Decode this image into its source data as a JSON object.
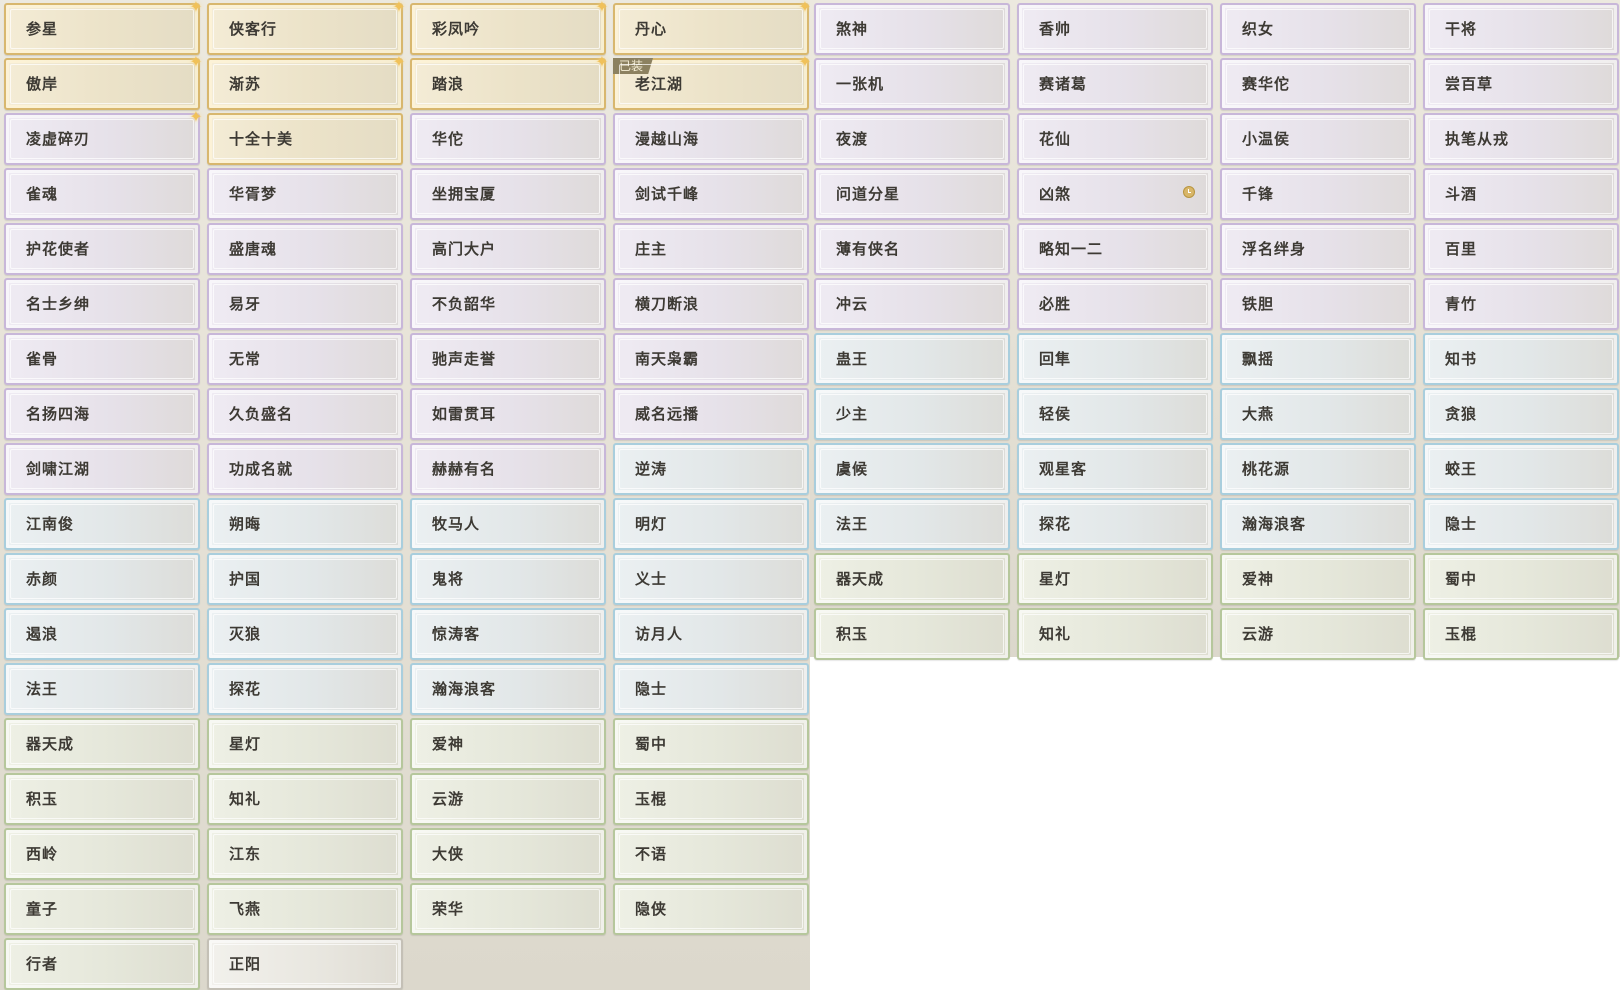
{
  "left_panel": {
    "tiles": [
      {
        "label": "参星",
        "style": "gold",
        "sparkle": true
      },
      {
        "label": "侠客行",
        "style": "gold",
        "sparkle": true
      },
      {
        "label": "彩凤吟",
        "style": "gold",
        "sparkle": true
      },
      {
        "label": "丹心",
        "style": "gold",
        "sparkle": true
      },
      {
        "label": "傲岸",
        "style": "gold",
        "sparkle": true
      },
      {
        "label": "渐苏",
        "style": "gold",
        "sparkle": true
      },
      {
        "label": "踏浪",
        "style": "gold",
        "sparkle": true
      },
      {
        "label": "老江湖",
        "style": "gold",
        "sparkle": true,
        "badge": "已装"
      },
      {
        "label": "凌虚碎刃",
        "style": "purple",
        "sparkle": true
      },
      {
        "label": "十全十美",
        "style": "gold"
      },
      {
        "label": "华佗",
        "style": "purple"
      },
      {
        "label": "漫越山海",
        "style": "purple"
      },
      {
        "label": "雀魂",
        "style": "purple"
      },
      {
        "label": "华胥梦",
        "style": "purple"
      },
      {
        "label": "坐拥宝厦",
        "style": "purple"
      },
      {
        "label": "剑试千峰",
        "style": "purple"
      },
      {
        "label": "护花使者",
        "style": "purple"
      },
      {
        "label": "盛唐魂",
        "style": "purple"
      },
      {
        "label": "高门大户",
        "style": "purple"
      },
      {
        "label": "庄主",
        "style": "purple"
      },
      {
        "label": "名士乡绅",
        "style": "purple"
      },
      {
        "label": "易牙",
        "style": "purple"
      },
      {
        "label": "不负韶华",
        "style": "purple"
      },
      {
        "label": "横刀断浪",
        "style": "purple"
      },
      {
        "label": "雀骨",
        "style": "purple"
      },
      {
        "label": "无常",
        "style": "purple"
      },
      {
        "label": "驰声走誉",
        "style": "purple"
      },
      {
        "label": "南天枭霸",
        "style": "purple"
      },
      {
        "label": "名扬四海",
        "style": "purple"
      },
      {
        "label": "久负盛名",
        "style": "purple"
      },
      {
        "label": "如雷贯耳",
        "style": "purple"
      },
      {
        "label": "威名远播",
        "style": "purple"
      },
      {
        "label": "剑啸江湖",
        "style": "purple"
      },
      {
        "label": "功成名就",
        "style": "purple"
      },
      {
        "label": "赫赫有名",
        "style": "purple"
      },
      {
        "label": "逆涛",
        "style": "blue"
      },
      {
        "label": "江南俊",
        "style": "blue"
      },
      {
        "label": "朔晦",
        "style": "blue"
      },
      {
        "label": "牧马人",
        "style": "blue"
      },
      {
        "label": "明灯",
        "style": "blue"
      },
      {
        "label": "赤颜",
        "style": "blue"
      },
      {
        "label": "护国",
        "style": "blue"
      },
      {
        "label": "鬼将",
        "style": "blue"
      },
      {
        "label": "义士",
        "style": "blue"
      },
      {
        "label": "遏浪",
        "style": "blue"
      },
      {
        "label": "灭狼",
        "style": "blue"
      },
      {
        "label": "惊涛客",
        "style": "blue"
      },
      {
        "label": "访月人",
        "style": "blue"
      },
      {
        "label": "法王",
        "style": "blue"
      },
      {
        "label": "探花",
        "style": "blue"
      },
      {
        "label": "瀚海浪客",
        "style": "blue"
      },
      {
        "label": "隐士",
        "style": "blue"
      },
      {
        "label": "器天成",
        "style": "green"
      },
      {
        "label": "星灯",
        "style": "green"
      },
      {
        "label": "爱神",
        "style": "green"
      },
      {
        "label": "蜀中",
        "style": "green"
      },
      {
        "label": "积玉",
        "style": "green"
      },
      {
        "label": "知礼",
        "style": "green"
      },
      {
        "label": "云游",
        "style": "green"
      },
      {
        "label": "玉棍",
        "style": "green"
      },
      {
        "label": "西岭",
        "style": "green"
      },
      {
        "label": "江东",
        "style": "green"
      },
      {
        "label": "大侠",
        "style": "green"
      },
      {
        "label": "不语",
        "style": "green"
      },
      {
        "label": "童子",
        "style": "green"
      },
      {
        "label": "飞燕",
        "style": "green"
      },
      {
        "label": "荣华",
        "style": "green"
      },
      {
        "label": "隐侠",
        "style": "green"
      },
      {
        "label": "行者",
        "style": "green"
      },
      {
        "label": "正阳",
        "style": "plain"
      }
    ]
  },
  "right_panel": {
    "tiles": [
      {
        "label": "煞神",
        "style": "purple"
      },
      {
        "label": "香帅",
        "style": "purple"
      },
      {
        "label": "织女",
        "style": "purple"
      },
      {
        "label": "干将",
        "style": "purple"
      },
      {
        "label": "一张机",
        "style": "purple"
      },
      {
        "label": "赛诸葛",
        "style": "purple"
      },
      {
        "label": "赛华佗",
        "style": "purple"
      },
      {
        "label": "尝百草",
        "style": "purple"
      },
      {
        "label": "夜渡",
        "style": "purple"
      },
      {
        "label": "花仙",
        "style": "purple"
      },
      {
        "label": "小温侯",
        "style": "purple"
      },
      {
        "label": "执笔从戎",
        "style": "purple"
      },
      {
        "label": "问道分星",
        "style": "purple"
      },
      {
        "label": "凶煞",
        "style": "purple",
        "timer_icon": "clock-icon"
      },
      {
        "label": "千锋",
        "style": "purple"
      },
      {
        "label": "斗酒",
        "style": "purple"
      },
      {
        "label": "薄有侠名",
        "style": "purple"
      },
      {
        "label": "略知一二",
        "style": "purple"
      },
      {
        "label": "浮名绊身",
        "style": "purple"
      },
      {
        "label": "百里",
        "style": "purple"
      },
      {
        "label": "冲云",
        "style": "purple"
      },
      {
        "label": "必胜",
        "style": "purple"
      },
      {
        "label": "铁胆",
        "style": "purple"
      },
      {
        "label": "青竹",
        "style": "purple"
      },
      {
        "label": "蛊王",
        "style": "blue"
      },
      {
        "label": "回隼",
        "style": "blue"
      },
      {
        "label": "飘摇",
        "style": "blue"
      },
      {
        "label": "知书",
        "style": "blue"
      },
      {
        "label": "少主",
        "style": "blue"
      },
      {
        "label": "轻侯",
        "style": "blue"
      },
      {
        "label": "大燕",
        "style": "blue"
      },
      {
        "label": "贪狼",
        "style": "blue"
      },
      {
        "label": "虞候",
        "style": "blue"
      },
      {
        "label": "观星客",
        "style": "blue"
      },
      {
        "label": "桃花源",
        "style": "blue"
      },
      {
        "label": "蛟王",
        "style": "blue"
      },
      {
        "label": "法王",
        "style": "blue"
      },
      {
        "label": "探花",
        "style": "blue"
      },
      {
        "label": "瀚海浪客",
        "style": "blue"
      },
      {
        "label": "隐士",
        "style": "blue"
      },
      {
        "label": "器天成",
        "style": "green"
      },
      {
        "label": "星灯",
        "style": "green"
      },
      {
        "label": "爱神",
        "style": "green"
      },
      {
        "label": "蜀中",
        "style": "green"
      },
      {
        "label": "积玉",
        "style": "green"
      },
      {
        "label": "知礼",
        "style": "green"
      },
      {
        "label": "云游",
        "style": "green"
      },
      {
        "label": "玉棍",
        "style": "green"
      }
    ]
  }
}
